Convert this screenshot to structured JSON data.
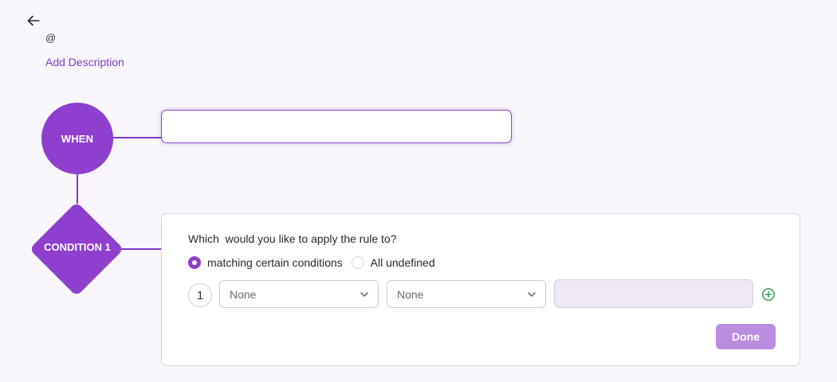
{
  "header": {
    "at_text": "@",
    "add_description": "Add Description"
  },
  "flow": {
    "when_label": "WHEN",
    "condition_label": "CONDITION 1"
  },
  "when_input": {
    "value": "",
    "placeholder": ""
  },
  "condition": {
    "question": "Which  would you like to apply the rule to?",
    "options": [
      {
        "label": "matching certain conditions",
        "selected": true
      },
      {
        "label": "All undefined",
        "selected": false
      }
    ],
    "row_number": "1",
    "field_select": "None",
    "operator_select": "None",
    "value": "",
    "done_label": "Done"
  },
  "colors": {
    "accent": "#8e3fce",
    "link": "#7b3fc4",
    "done_button": "#b98ce0",
    "add_icon": "#2fa35a"
  }
}
